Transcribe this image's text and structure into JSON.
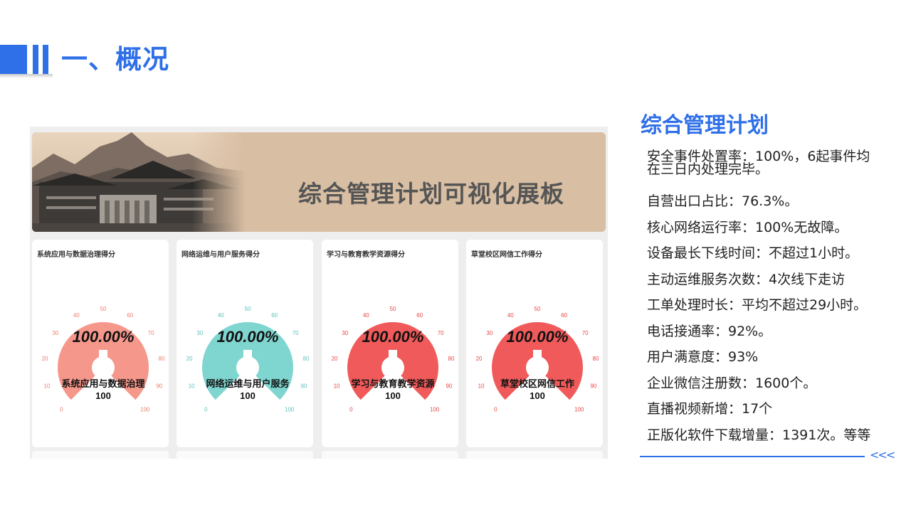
{
  "header": {
    "title": "一、概况"
  },
  "banner": {
    "title": "综合管理计划可视化展板"
  },
  "cards": [
    {
      "title": "系统应用与数据治理得分",
      "percent_text": "100.00%",
      "name": "系统应用与数据治理",
      "score": "100",
      "value": 100,
      "color": "#f5978b",
      "tick_color": "#f07d6e"
    },
    {
      "title": "网络运维与用户服务得分",
      "percent_text": "100.00%",
      "name": "网络运维与用户服务",
      "score": "100",
      "value": 100,
      "color": "#7fd5cf",
      "tick_color": "#5cc2bb"
    },
    {
      "title": "学习与教育教学资源得分",
      "percent_text": "100.00%",
      "name": "学习与教育教学资源",
      "score": "100",
      "value": 100,
      "color": "#f05a5a",
      "tick_color": "#e94848"
    },
    {
      "title": "草堂校区网信工作得分",
      "percent_text": "100.00%",
      "name": "草堂校区网信工作",
      "score": "100",
      "value": 100,
      "color": "#f05a5a",
      "tick_color": "#e94848"
    }
  ],
  "gauge_ticks": [
    "0",
    "10",
    "20",
    "30",
    "40",
    "50",
    "60",
    "70",
    "80",
    "90",
    "100"
  ],
  "right": {
    "title": "综合管理计划",
    "items": [
      "安全事件处置率：100%，6起事件均",
      "在三日内处理完毕。",
      "自营出口占比：76.3%。",
      "核心网络运行率：100%无故障。",
      "设备最长下线时间：不超过1小时。",
      "主动运维服务次数：4次线下走访",
      "工单处理时长：平均不超过29小时。",
      "电话接通率：92%。",
      "用户满意度：93%",
      "企业微信注册数：1600个。",
      "直播视频新增：17个",
      "正版化软件下载增量：1391次。等等"
    ],
    "chevrons": "<<<"
  },
  "colors": {
    "accent": "#2f6fe8"
  }
}
